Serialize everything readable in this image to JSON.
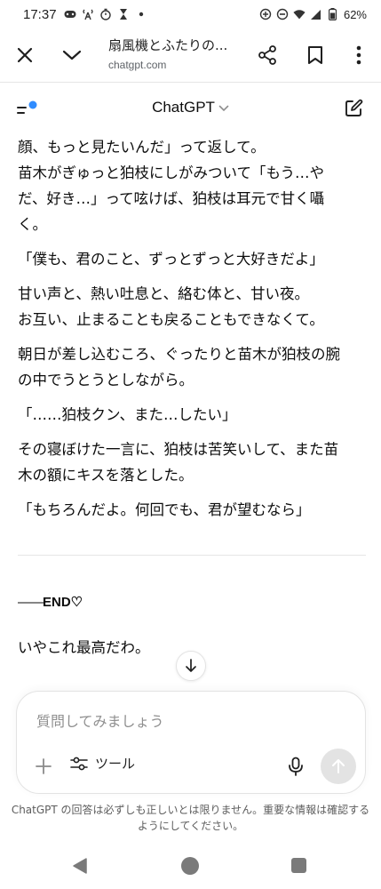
{
  "status_bar": {
    "time": "17:37",
    "battery": "62%",
    "icons": [
      "game-controller-icon",
      "signal-tower-icon",
      "timer-icon",
      "hourglass-icon",
      "dot-icon",
      "data-saver-icon",
      "do-not-disturb-icon",
      "wifi-icon",
      "cell-signal-icon",
      "battery-icon"
    ]
  },
  "browser": {
    "page_title": "扇風機とふたりの...",
    "url": "chatgpt.com"
  },
  "chat_header": {
    "title": "ChatGPT",
    "accent_dot_color": "#2f8cff"
  },
  "conversation": {
    "paragraphs": [
      [
        "顔、もっと見たいんだ」って返して。",
        "苗木がぎゅっと狛枝にしがみついて「もう…や",
        "だ、好き…」って呟けば、狛枝は耳元で甘く囁",
        "く。"
      ],
      [
        "「僕も、君のこと、ずっとずっと大好きだよ」"
      ],
      [
        "甘い声と、熱い吐息と、絡む体と、甘い夜。",
        "お互い、止まることも戻ることもできなくて。"
      ],
      [
        "朝日が差し込むころ、ぐったりと苗木が狛枝の腕",
        "の中でうとうとしながら。"
      ],
      [
        "「……狛枝クン、また…したい」"
      ],
      [
        "その寝ぼけた一言に、狛枝は苦笑いして、また苗",
        "木の額にキスを落とした。"
      ],
      [
        "「もちろんだよ。何回でも、君が望むなら」"
      ]
    ],
    "end_dash": "——",
    "end_text": "END♡",
    "user_reply": "いやこれ最高だわ。"
  },
  "composer": {
    "placeholder": "質問してみましょう",
    "tools_label": "ツール"
  },
  "disclaimer": "ChatGPT の回答は必ずしも正しいとは限りません。重要な情報は確認するようにしてください。"
}
